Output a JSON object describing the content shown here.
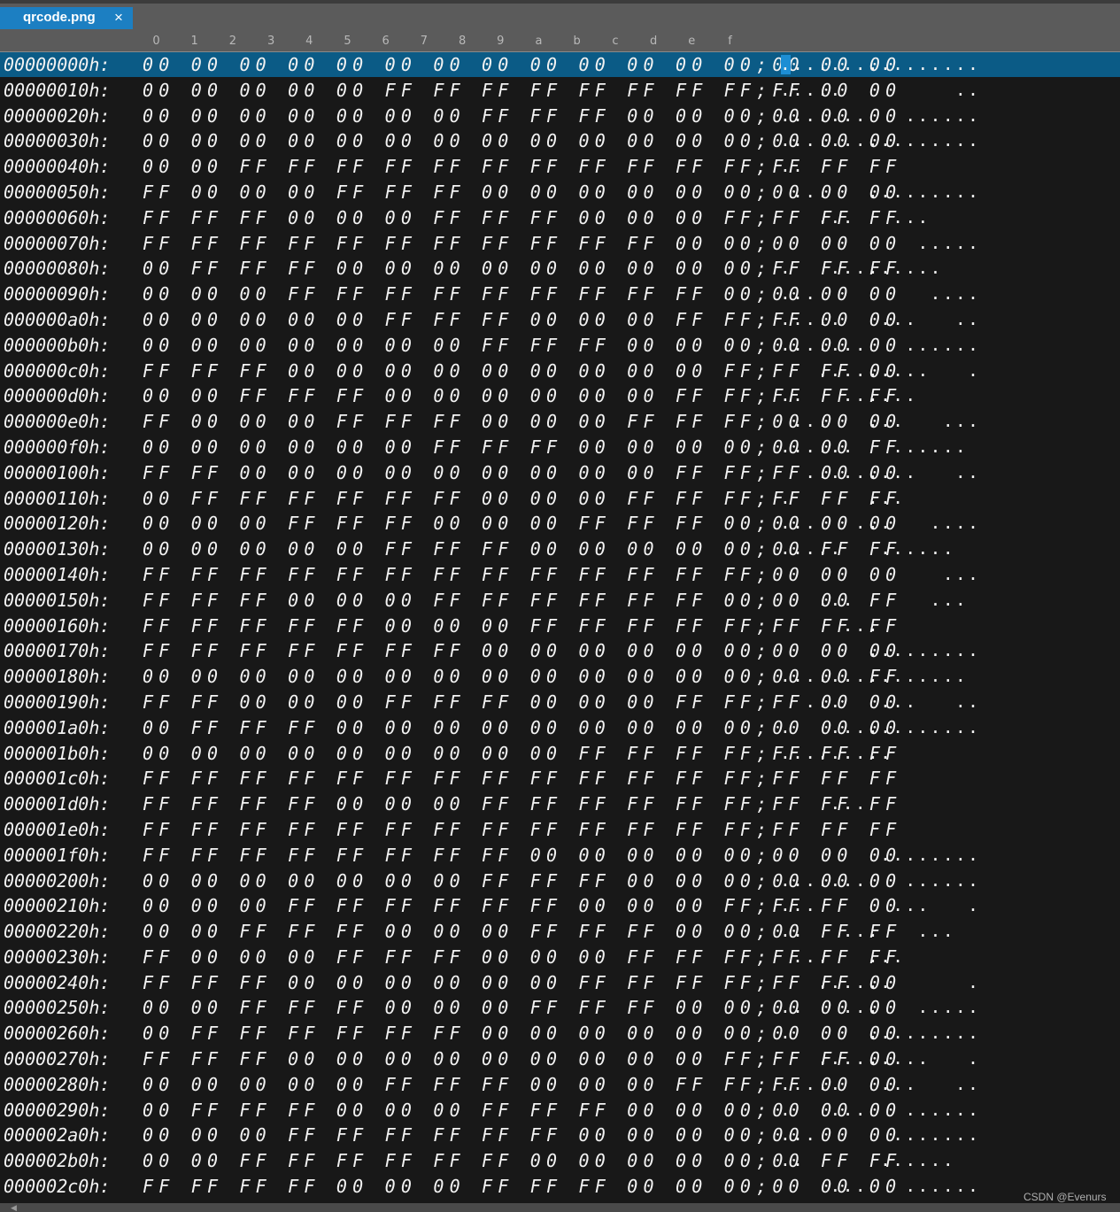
{
  "tab": {
    "title": "qrcode.png",
    "close_glyph": "×"
  },
  "column_headers": [
    "0",
    "1",
    "2",
    "3",
    "4",
    "5",
    "6",
    "7",
    "8",
    "9",
    "a",
    "b",
    "c",
    "d",
    "e",
    "f"
  ],
  "separator": ";",
  "rows": [
    {
      "addr": "00000000h:",
      "bytes": "00 00 00 00 00 00 00 00 00 00 00 00 00 00 00 00",
      "ascii": "................"
    },
    {
      "addr": "00000010h:",
      "bytes": "00 00 00 00 00 FF FF FF FF FF FF FF FF FF 00 00",
      "ascii": ".....         .."
    },
    {
      "addr": "00000020h:",
      "bytes": "00 00 00 00 00 00 00 FF FF FF 00 00 00 00 00 00",
      "ascii": ".......   ......"
    },
    {
      "addr": "00000030h:",
      "bytes": "00 00 00 00 00 00 00 00 00 00 00 00 00 00 00 00",
      "ascii": "................"
    },
    {
      "addr": "00000040h:",
      "bytes": "00 00 FF FF FF FF FF FF FF FF FF FF FF FF FF FF",
      "ascii": "..              "
    },
    {
      "addr": "00000050h:",
      "bytes": "FF 00 00 00 FF FF FF 00 00 00 00 00 00 00 00 00",
      "ascii": " ...   ........."
    },
    {
      "addr": "00000060h:",
      "bytes": "FF FF FF 00 00 00 FF FF FF 00 00 00 FF FF FF FF",
      "ascii": "   ...   ...    "
    },
    {
      "addr": "00000070h:",
      "bytes": "FF FF FF FF FF FF FF FF FF FF FF 00 00 00 00 00",
      "ascii": "           ....."
    },
    {
      "addr": "00000080h:",
      "bytes": "00 FF FF FF 00 00 00 00 00 00 00 00 00 FF FF FF",
      "ascii": ".   .........   "
    },
    {
      "addr": "00000090h:",
      "bytes": "00 00 00 FF FF FF FF FF FF FF FF FF 00 00 00 00",
      "ascii": "...         ...."
    },
    {
      "addr": "000000a0h:",
      "bytes": "00 00 00 00 00 FF FF FF 00 00 00 FF FF FF 00 00",
      "ascii": ".....   ...   .."
    },
    {
      "addr": "000000b0h:",
      "bytes": "00 00 00 00 00 00 00 FF FF FF 00 00 00 00 00 00",
      "ascii": ".......   ......"
    },
    {
      "addr": "000000c0h:",
      "bytes": "FF FF FF 00 00 00 00 00 00 00 00 00 FF FF FF 00",
      "ascii": "   .........   ."
    },
    {
      "addr": "000000d0h:",
      "bytes": "00 00 FF FF FF 00 00 00 00 00 00 FF FF FF FF FF",
      "ascii": "..   ......     "
    },
    {
      "addr": "000000e0h:",
      "bytes": "FF 00 00 00 FF FF FF 00 00 00 FF FF FF 00 00 00",
      "ascii": " ...   ...   ..."
    },
    {
      "addr": "000000f0h:",
      "bytes": "00 00 00 00 00 00 FF FF FF 00 00 00 00 00 00 FF",
      "ascii": "......   ...... "
    },
    {
      "addr": "00000100h:",
      "bytes": "FF FF 00 00 00 00 00 00 00 00 00 FF FF FF 00 00",
      "ascii": "  .........   .."
    },
    {
      "addr": "00000110h:",
      "bytes": "00 FF FF FF FF FF FF 00 00 00 FF FF FF FF FF FF",
      "ascii": ".      ...      "
    },
    {
      "addr": "00000120h:",
      "bytes": "00 00 00 FF FF FF 00 00 00 FF FF FF 00 00 00 00",
      "ascii": "...   ...   ...."
    },
    {
      "addr": "00000130h:",
      "bytes": "00 00 00 00 00 FF FF FF 00 00 00 00 00 00 FF FF",
      "ascii": ".....   ......  "
    },
    {
      "addr": "00000140h:",
      "bytes": "FF FF FF FF FF FF FF FF FF FF FF FF FF 00 00 00",
      "ascii": "             ..."
    },
    {
      "addr": "00000150h:",
      "bytes": "FF FF FF 00 00 00 FF FF FF FF FF FF 00 00 00 FF",
      "ascii": "   ...      ... "
    },
    {
      "addr": "00000160h:",
      "bytes": "FF FF FF FF FF 00 00 00 FF FF FF FF FF FF FF FF",
      "ascii": "     ...        "
    },
    {
      "addr": "00000170h:",
      "bytes": "FF FF FF FF FF FF FF 00 00 00 00 00 00 00 00 00",
      "ascii": "       ........."
    },
    {
      "addr": "00000180h:",
      "bytes": "00 00 00 00 00 00 00 00 00 00 00 00 00 00 00 FF",
      "ascii": "............... "
    },
    {
      "addr": "00000190h:",
      "bytes": "FF FF 00 00 00 FF FF FF 00 00 00 FF FF FF 00 00",
      "ascii": "  ...   ...   .."
    },
    {
      "addr": "000001a0h:",
      "bytes": "00 FF FF FF 00 00 00 00 00 00 00 00 00 00 00 00",
      "ascii": ".   ............"
    },
    {
      "addr": "000001b0h:",
      "bytes": "00 00 00 00 00 00 00 00 00 FF FF FF FF FF FF FF",
      "ascii": ".........       "
    },
    {
      "addr": "000001c0h:",
      "bytes": "FF FF FF FF FF FF FF FF FF FF FF FF FF FF FF FF",
      "ascii": "                "
    },
    {
      "addr": "000001d0h:",
      "bytes": "FF FF FF FF 00 00 00 FF FF FF FF FF FF FF FF FF",
      "ascii": "    ...         "
    },
    {
      "addr": "000001e0h:",
      "bytes": "FF FF FF FF FF FF FF FF FF FF FF FF FF FF FF FF",
      "ascii": "                "
    },
    {
      "addr": "000001f0h:",
      "bytes": "FF FF FF FF FF FF FF FF 00 00 00 00 00 00 00 00",
      "ascii": "        ........"
    },
    {
      "addr": "00000200h:",
      "bytes": "00 00 00 00 00 00 00 FF FF FF 00 00 00 00 00 00",
      "ascii": ".......   ......"
    },
    {
      "addr": "00000210h:",
      "bytes": "00 00 00 FF FF FF FF FF FF 00 00 00 FF FF FF 00",
      "ascii": "...      ...   ."
    },
    {
      "addr": "00000220h:",
      "bytes": "00 00 FF FF FF 00 00 00 FF FF FF 00 00 00 FF FF",
      "ascii": "..   ...   ...  "
    },
    {
      "addr": "00000230h:",
      "bytes": "FF 00 00 00 FF FF FF 00 00 00 FF FF FF FF FF FF",
      "ascii": " ...   ...      "
    },
    {
      "addr": "00000240h:",
      "bytes": "FF FF FF 00 00 00 00 00 00 FF FF FF FF FF FF 00",
      "ascii": "   ......      ."
    },
    {
      "addr": "00000250h:",
      "bytes": "00 00 FF FF FF 00 00 00 FF FF FF 00 00 00 00 00",
      "ascii": "..   ...   ....."
    },
    {
      "addr": "00000260h:",
      "bytes": "00 FF FF FF FF FF FF 00 00 00 00 00 00 00 00 00",
      "ascii": ".      ........."
    },
    {
      "addr": "00000270h:",
      "bytes": "FF FF FF 00 00 00 00 00 00 00 00 00 FF FF FF 00",
      "ascii": "   .........   ."
    },
    {
      "addr": "00000280h:",
      "bytes": "00 00 00 00 00 FF FF FF 00 00 00 FF FF FF 00 00",
      "ascii": ".....   ...   .."
    },
    {
      "addr": "00000290h:",
      "bytes": "00 FF FF FF 00 00 00 FF FF FF 00 00 00 00 00 00",
      "ascii": ".   ...   ......"
    },
    {
      "addr": "000002a0h:",
      "bytes": "00 00 00 FF FF FF FF FF FF 00 00 00 00 00 00 00",
      "ascii": "...      ......."
    },
    {
      "addr": "000002b0h:",
      "bytes": "00 00 FF FF FF FF FF FF 00 00 00 00 00 00 FF FF",
      "ascii": "..      ......  "
    },
    {
      "addr": "000002c0h:",
      "bytes": "FF FF FF FF 00 00 00 FF FF FF 00 00 00 00 00 00",
      "ascii": "    ...   ......"
    }
  ],
  "watermark": "CSDN @Evenurs",
  "colors": {
    "selection": "#0b5b86",
    "tab_active": "#1c7fc2",
    "background": "#181818",
    "chrome": "#5b5b5b"
  },
  "icons": {
    "close": "close-icon",
    "scroll_left": "arrow-left-icon"
  }
}
